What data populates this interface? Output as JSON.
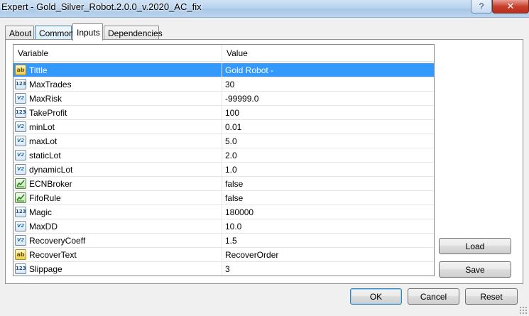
{
  "window": {
    "title": "Expert - Gold_Silver_Robot.2.0.0_v.2020_AC_fix",
    "help_glyph": "?",
    "close_glyph": "✕"
  },
  "tabs": [
    {
      "label": "About"
    },
    {
      "label": "Common"
    },
    {
      "label": "Inputs",
      "active": true
    },
    {
      "label": "Dependencies"
    }
  ],
  "grid": {
    "columns": [
      "Variable",
      "Value"
    ],
    "rows": [
      {
        "icon": "text-type-icon",
        "icon_text": "ab",
        "variable": "Tittle",
        "value": "Gold Robot -",
        "selected": true
      },
      {
        "icon": "integer-type-icon",
        "icon_text": "123",
        "variable": "MaxTrades",
        "value": "30"
      },
      {
        "icon": "double-type-icon",
        "icon_text": "V2",
        "variable": "MaxRisk",
        "value": "-99999.0"
      },
      {
        "icon": "integer-type-icon",
        "icon_text": "123",
        "variable": "TakeProfit",
        "value": "100"
      },
      {
        "icon": "double-type-icon",
        "icon_text": "V2",
        "variable": "minLot",
        "value": "0.01"
      },
      {
        "icon": "double-type-icon",
        "icon_text": "V2",
        "variable": "maxLot",
        "value": "5.0"
      },
      {
        "icon": "double-type-icon",
        "icon_text": "V2",
        "variable": "staticLot",
        "value": "2.0"
      },
      {
        "icon": "double-type-icon",
        "icon_text": "V2",
        "variable": "dynamicLot",
        "value": "1.0"
      },
      {
        "icon": "bool-type-icon",
        "icon_text": "",
        "variable": "ECNBroker",
        "value": "false"
      },
      {
        "icon": "bool-type-icon",
        "icon_text": "",
        "variable": "FifoRule",
        "value": "false"
      },
      {
        "icon": "integer-type-icon",
        "icon_text": "123",
        "variable": "Magic",
        "value": "180000"
      },
      {
        "icon": "double-type-icon",
        "icon_text": "V2",
        "variable": "MaxDD",
        "value": "10.0"
      },
      {
        "icon": "double-type-icon",
        "icon_text": "V2",
        "variable": "RecoveryCoeff",
        "value": "1.5"
      },
      {
        "icon": "text-type-icon",
        "icon_text": "ab",
        "variable": "RecoverText",
        "value": "RecoverOrder"
      },
      {
        "icon": "integer-type-icon",
        "icon_text": "123",
        "variable": "Slippage",
        "value": "3"
      }
    ]
  },
  "side_buttons": {
    "load": "Load",
    "save": "Save"
  },
  "footer_buttons": {
    "ok": "OK",
    "cancel": "Cancel",
    "reset": "Reset"
  },
  "colors": {
    "selection": "#3399ff",
    "title_bar": "#b9d4ee",
    "close_button": "#c7402d"
  }
}
